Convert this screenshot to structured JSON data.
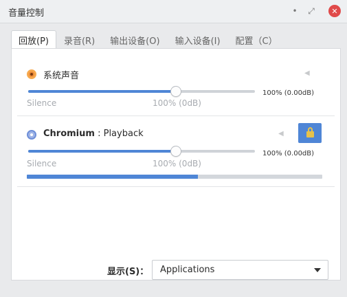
{
  "window": {
    "title": "音量控制",
    "minimize_glyph": "•",
    "maximize_glyph": "⤢",
    "close_glyph": "✕"
  },
  "tabs": [
    {
      "label": "回放(P)",
      "active": true
    },
    {
      "label": "录音(R)",
      "active": false
    },
    {
      "label": "输出设备(O)",
      "active": false
    },
    {
      "label": "输入设备(I)",
      "active": false
    },
    {
      "label": "配置（C）",
      "active": false
    }
  ],
  "streams": [
    {
      "name": "系统声音",
      "icon": "speaker-icon",
      "volume_fraction": 0.65,
      "volume_text": "100% (0.00dB)",
      "tick_silence": "Silence",
      "tick_100": "100% (0dB)",
      "muted": false,
      "mute_glyph": "◀"
    },
    {
      "app": "Chromium",
      "separator": " : ",
      "detail": "Playback",
      "icon": "chromium-icon",
      "volume_fraction": 0.65,
      "volume_text": "100% (0.00dB)",
      "tick_silence": "Silence",
      "tick_100": "100% (0dB)",
      "level_fraction": 0.58,
      "muted": false,
      "lock_icon": "lock-icon",
      "mute_glyph": "◀"
    }
  ],
  "footer": {
    "show_label": "显示(S)：",
    "select_value": "Applications"
  },
  "colors": {
    "accent": "#4f86d6",
    "close": "#e04a4a",
    "lock": "#e7c24a"
  }
}
